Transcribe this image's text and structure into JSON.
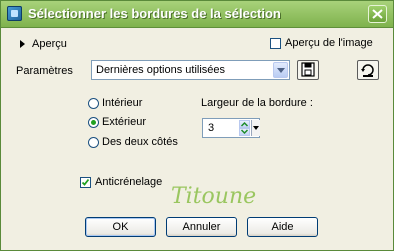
{
  "window": {
    "title": "Sélectionner les bordures de la sélection"
  },
  "preview": {
    "label": "Aperçu",
    "image_preview_label": "Aperçu de l'image",
    "image_preview_checked": false
  },
  "params": {
    "label": "Paramètres",
    "preset_value": "Dernières options utilisées"
  },
  "border": {
    "options": [
      "Intérieur",
      "Extérieur",
      "Des deux côtés"
    ],
    "selected": "Extérieur",
    "width_label": "Largeur de la bordure :",
    "width_value": "3"
  },
  "antialias": {
    "label": "Anticrénelage",
    "checked": true
  },
  "watermark": "Titoune",
  "buttons": {
    "ok": "OK",
    "cancel": "Annuler",
    "help": "Aide"
  },
  "colors": {
    "titlebar": "#8fc05c",
    "radio_selected": "#21a121",
    "watermark": "#8cc04a"
  },
  "icons": [
    "app-icon",
    "close-icon",
    "expand-arrow-icon",
    "save-preset-icon",
    "reset-icon",
    "chevron-down-icon",
    "check-icon"
  ]
}
